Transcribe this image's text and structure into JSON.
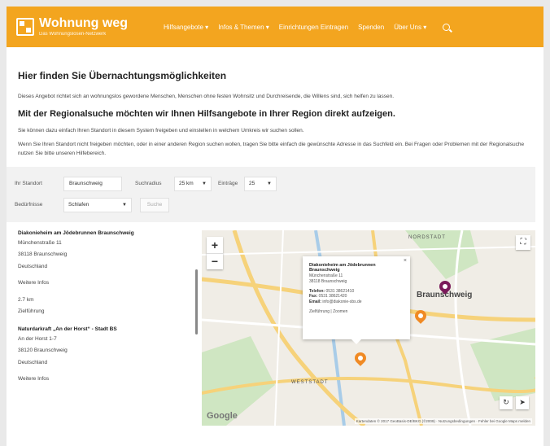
{
  "header": {
    "logo_title": "Wohnung weg",
    "logo_subtitle": "Das Wohnungslosen-Netzwerk",
    "nav": [
      {
        "label": "Hilfsangebote",
        "has_dropdown": true
      },
      {
        "label": "Infos & Themen",
        "has_dropdown": true
      },
      {
        "label": "Einrichtungen Eintragen",
        "has_dropdown": false
      },
      {
        "label": "Spenden",
        "has_dropdown": false
      },
      {
        "label": "Über Uns",
        "has_dropdown": true
      }
    ],
    "accent": "#f3a51f"
  },
  "main": {
    "title": "Hier finden Sie Übernachtungsmöglichkeiten",
    "intro": "Dieses Angebot richtet sich an wohnungslos gewordene Menschen, Menschen ohne festen Wohnsitz und Durchreisende, die Willens sind, sich helfen zu lassen.",
    "subtitle": "Mit der Regionalsuche möchten wir Ihnen Hilfsangebote in Ihrer Region direkt aufzeigen.",
    "para1": "Sie können dazu einfach Ihren Standort in diesem System freigeben und einstellen in welchem Umkreis wir suchen sollen.",
    "para2": "Wenn Sie Ihren Standort nicht freigeben möchten, oder in einer anderen Region suchen wollen, tragen Sie bitte einfach die gewünschte Adresse in das Suchfeld ein. Bei Fragen oder Problemen mit der Regionalsuche nutzen Sie bitte unseren Hilfebereich."
  },
  "form": {
    "location_label": "Ihr Standort",
    "location_value": "Braunschweig",
    "radius_label": "Suchradius",
    "radius_value": "25 km",
    "results_label": "Einträge",
    "results_value": "25",
    "need_label": "Bedürfnisse",
    "need_value": "Schlafen",
    "search_button": "Suche"
  },
  "results": [
    {
      "name": "Diakonieheim am Jödebrunnen Braunschweig",
      "street": "Münchenstraße 11",
      "city": "38118 Braunschweig",
      "country": "Deutschland",
      "more": "Weitere Infos",
      "distance": "2.7 km",
      "route": "Zielführung"
    },
    {
      "name": "Naturdarkraft „An der Horst“ - Stadt BS",
      "street": "An der Horst 1-7",
      "city": "38120 Braunschweig",
      "country": "Deutschland",
      "more": "Weitere Infos"
    }
  ],
  "map": {
    "labels": {
      "district_north": "NORDSTADT",
      "district_west": "WESTSTADT",
      "city": "Braunschweig"
    },
    "google": "Google",
    "attribution": "Kartendaten © 2017 GeoBasis-DE/BKG (©2009) · Nutzungsbedingungen · Fehler bei Google Maps melden",
    "info": {
      "title": "Diakonieheim am Jödebrunnen Braunschweig",
      "street": "Münchenstraße 11",
      "city": "38118 Braunschweig",
      "phone_label": "Telefon:",
      "phone": "0531 38621410",
      "fax_label": "Fax:",
      "fax": "0531 38621420",
      "email_label": "Email:",
      "email": "info@diakonie-sbs.de",
      "route": "Zielführung",
      "route_sep": "|",
      "zoom": "Zoomen"
    },
    "colors": {
      "pin_orange": "#f08a24",
      "pin_purple": "#7a1a5a",
      "road": "#f6d27a",
      "park": "#cfe6c2",
      "water": "#a8cce8"
    }
  }
}
